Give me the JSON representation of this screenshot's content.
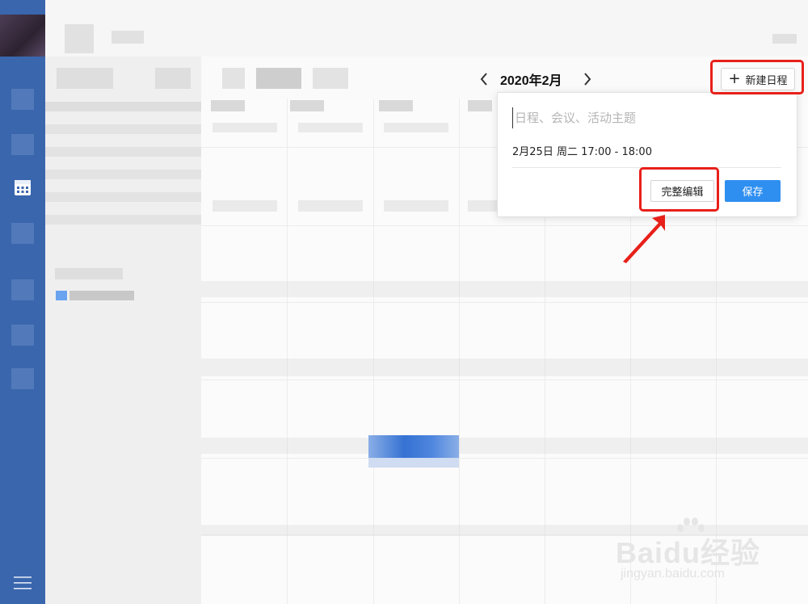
{
  "calendar": {
    "month_title": "2020年2月",
    "prev_icon": "chevron-left-icon",
    "next_icon": "chevron-right-icon",
    "new_event_label": "新建日程"
  },
  "quick_create": {
    "title_placeholder": "日程、会议、活动主题",
    "time_text": "2月25日 周二 17:00 - 18:00",
    "full_edit_label": "完整编辑",
    "save_label": "保存"
  },
  "watermark": {
    "brand": "Baidu经验",
    "url": "jingyan.baidu.com"
  },
  "colors": {
    "rail": "#3a66ad",
    "primary_button": "#2f8ff0",
    "annotation_red": "#e8201a"
  }
}
